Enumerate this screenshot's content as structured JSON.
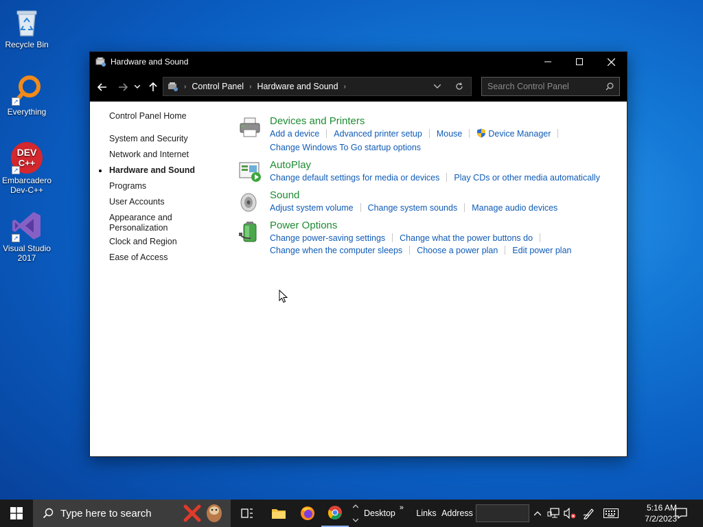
{
  "desktop": {
    "icons": [
      {
        "label": "Recycle Bin"
      },
      {
        "label": "Everything"
      },
      {
        "label_line1": "Embarcadero",
        "label_line2": "Dev-C++",
        "badge_line1": "DEV",
        "badge_line2": "C++"
      },
      {
        "label_line1": "Visual Studio",
        "label_line2": "2017"
      }
    ]
  },
  "window": {
    "title": "Hardware and Sound",
    "breadcrumb": [
      "Control Panel",
      "Hardware and Sound"
    ],
    "search_placeholder": "Search Control Panel",
    "sidebar": {
      "home": "Control Panel Home",
      "items": [
        {
          "label": "System and Security"
        },
        {
          "label": "Network and Internet"
        },
        {
          "label": "Hardware and Sound",
          "active": true
        },
        {
          "label": "Programs"
        },
        {
          "label": "User Accounts"
        },
        {
          "label_line1": "Appearance and",
          "label_line2": "Personalization"
        },
        {
          "label": "Clock and Region"
        },
        {
          "label": "Ease of Access"
        }
      ]
    },
    "categories": [
      {
        "title": "Devices and Printers",
        "icon": "printer-icon",
        "links": [
          "Add a device",
          "Advanced printer setup",
          "Mouse",
          "Device Manager",
          "Change Windows To Go startup options"
        ]
      },
      {
        "title": "AutoPlay",
        "icon": "autoplay-icon",
        "links": [
          "Change default settings for media or devices",
          "Play CDs or other media automatically"
        ]
      },
      {
        "title": "Sound",
        "icon": "speaker-icon",
        "links": [
          "Adjust system volume",
          "Change system sounds",
          "Manage audio devices"
        ]
      },
      {
        "title": "Power Options",
        "icon": "battery-icon",
        "links": [
          "Change power-saving settings",
          "Change what the power buttons do",
          "Change when the computer sleeps",
          "Choose a power plan",
          "Edit power plan"
        ]
      }
    ]
  },
  "taskbar": {
    "search_placeholder": "Type here to search",
    "toolbar_desktop": "Desktop",
    "toolbar_chevron": "»",
    "toolbar_links": "Links",
    "toolbar_address": "Address",
    "time": "5:16 AM",
    "date": "7/2/2023"
  },
  "colors": {
    "link": "#0f5bb6",
    "category_title": "#1e8b32",
    "titlebar": "#000000",
    "taskbar": "#1a1a1a"
  }
}
